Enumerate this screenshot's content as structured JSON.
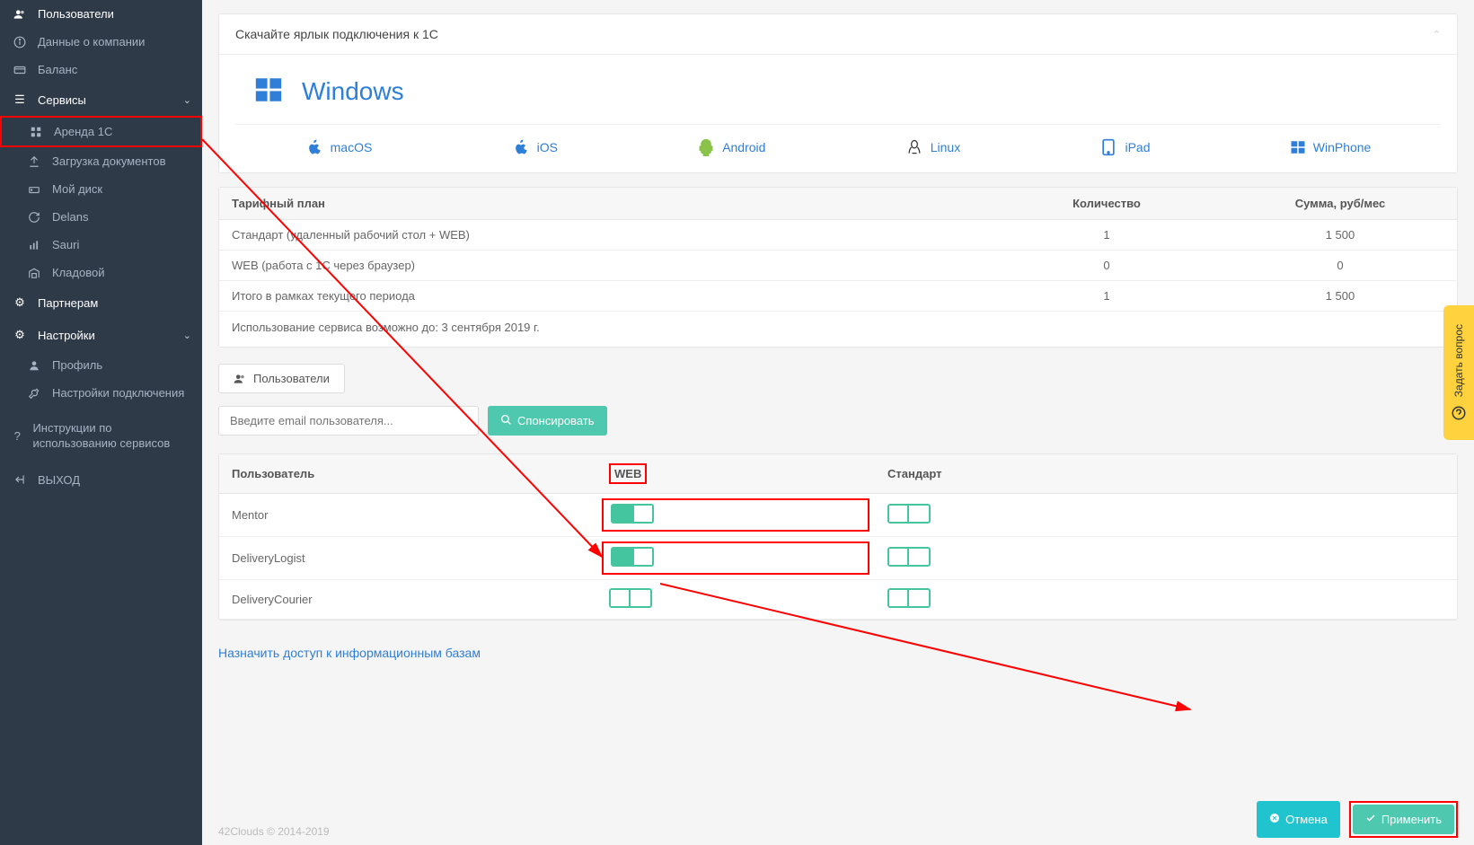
{
  "sidebar": {
    "users": "Пользователи",
    "company": "Данные о компании",
    "balance": "Баланс",
    "services": "Сервисы",
    "svc_rent1c": "Аренда 1С",
    "svc_upload": "Загрузка документов",
    "svc_mydisk": "Мой диск",
    "svc_delans": "Delans",
    "svc_sauri": "Sauri",
    "svc_klad": "Кладовой",
    "partners": "Партнерам",
    "settings": "Настройки",
    "profile": "Профиль",
    "conn_settings": "Настройки подключения",
    "instructions": "Инструкции по использованию сервисов",
    "logout": "ВЫХОД"
  },
  "download": {
    "title": "Скачайте ярлык подключения к 1С",
    "windows": "Windows",
    "macos": "macOS",
    "ios": "iOS",
    "android": "Android",
    "linux": "Linux",
    "ipad": "iPad",
    "winphone": "WinPhone"
  },
  "tariff": {
    "head_plan": "Тарифный план",
    "head_qty": "Количество",
    "head_sum": "Сумма, руб/мес",
    "rows": [
      {
        "name": "Стандарт (удаленный рабочий стол + WEB)",
        "qty": "1",
        "sum": "1 500"
      },
      {
        "name": "WEB (работа с 1С через браузер)",
        "qty": "0",
        "sum": "0"
      },
      {
        "name": "Итого в рамках текущего периода",
        "qty": "1",
        "sum": "1 500"
      }
    ],
    "note": "Использование сервиса возможно до: 3 сентября 2019 г."
  },
  "tabs": {
    "users": "Пользователи"
  },
  "form": {
    "placeholder": "Введите email пользователя...",
    "sponsor": "Спонсировать"
  },
  "users": {
    "head_user": "Пользователь",
    "head_web": "WEB",
    "head_std": "Стандарт",
    "rows": [
      {
        "name": "Mentor",
        "web": true,
        "std": false
      },
      {
        "name": "DeliveryLogist",
        "web": true,
        "std": false
      },
      {
        "name": "DeliveryCourier",
        "web": false,
        "std": false
      }
    ]
  },
  "access_link": "Назначить доступ к информационным базам",
  "buttons": {
    "cancel": "Отмена",
    "apply": "Применить"
  },
  "feedback": "Задать вопрос",
  "copyright": "42Clouds © 2014-2019"
}
